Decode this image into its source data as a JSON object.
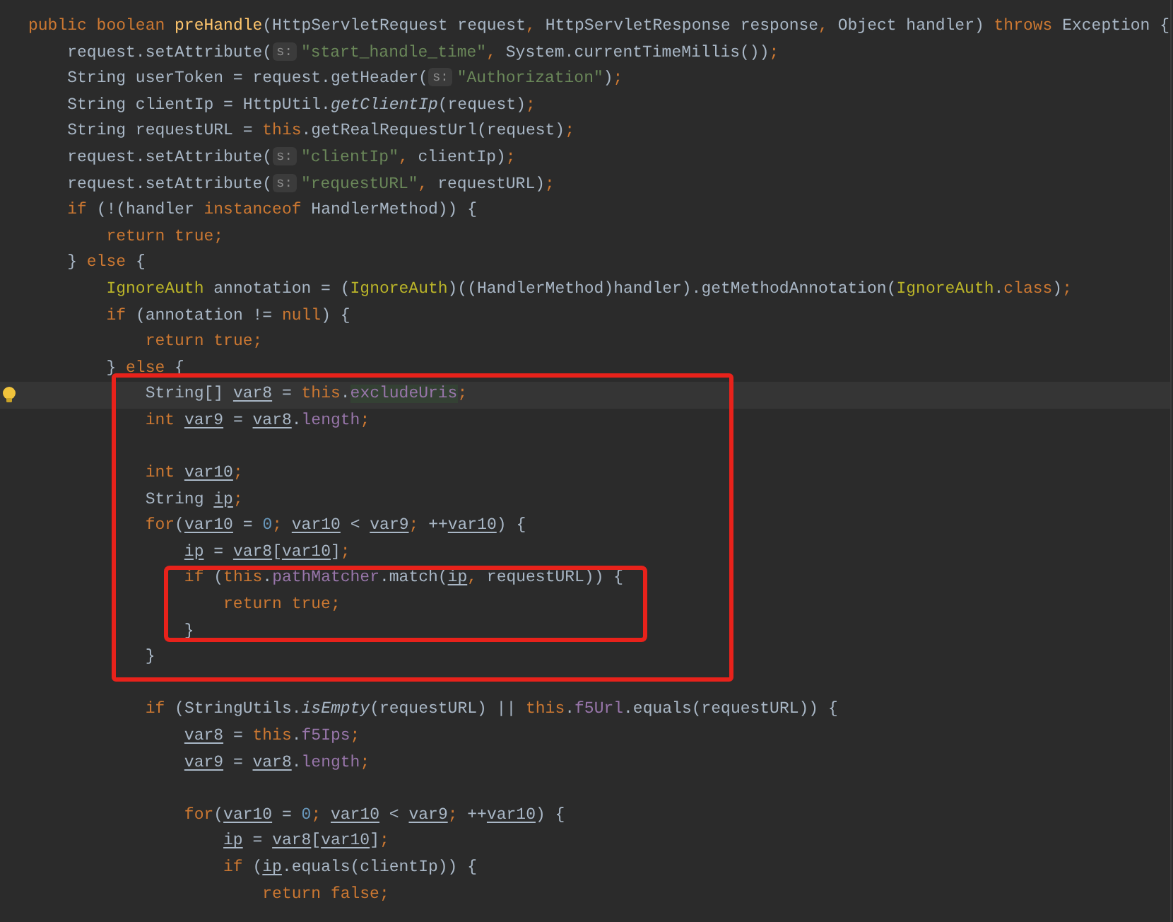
{
  "editor": {
    "lines": [
      {
        "current": false,
        "tokens": [
          {
            "kind": "kw",
            "text": "public boolean "
          },
          {
            "kind": "fn",
            "text": "preHandle"
          },
          {
            "kind": "plain",
            "text": "(HttpServletRequest request"
          },
          {
            "kind": "kw",
            "text": ", "
          },
          {
            "kind": "plain",
            "text": "HttpServletResponse response"
          },
          {
            "kind": "kw",
            "text": ", "
          },
          {
            "kind": "plain",
            "text": "Object handler) "
          },
          {
            "kind": "kw",
            "text": "throws "
          },
          {
            "kind": "plain",
            "text": "Exception {"
          }
        ]
      },
      {
        "current": false,
        "tokens": [
          {
            "kind": "plain",
            "text": "    request.setAttribute("
          },
          {
            "kind": "hint",
            "text": "s:"
          },
          {
            "kind": "str",
            "text": "\"start_handle_time\""
          },
          {
            "kind": "kw",
            "text": ", "
          },
          {
            "kind": "plain",
            "text": "System.currentTimeMillis())"
          },
          {
            "kind": "kw",
            "text": ";"
          }
        ]
      },
      {
        "current": false,
        "tokens": [
          {
            "kind": "plain",
            "text": "    String userToken = request.getHeader("
          },
          {
            "kind": "hint",
            "text": "s:"
          },
          {
            "kind": "str",
            "text": "\"Authorization\""
          },
          {
            "kind": "plain",
            "text": ")"
          },
          {
            "kind": "kw",
            "text": ";"
          }
        ]
      },
      {
        "current": false,
        "tokens": [
          {
            "kind": "plain",
            "text": "    String clientIp = HttpUtil."
          },
          {
            "kind": "static",
            "text": "getClientIp"
          },
          {
            "kind": "plain",
            "text": "(request)"
          },
          {
            "kind": "kw",
            "text": ";"
          }
        ]
      },
      {
        "current": false,
        "tokens": [
          {
            "kind": "plain",
            "text": "    String requestURL = "
          },
          {
            "kind": "kw",
            "text": "this"
          },
          {
            "kind": "plain",
            "text": ".getRealRequestUrl(request)"
          },
          {
            "kind": "kw",
            "text": ";"
          }
        ]
      },
      {
        "current": false,
        "tokens": [
          {
            "kind": "plain",
            "text": "    request.setAttribute("
          },
          {
            "kind": "hint",
            "text": "s:"
          },
          {
            "kind": "str",
            "text": "\"clientIp\""
          },
          {
            "kind": "kw",
            "text": ", "
          },
          {
            "kind": "plain",
            "text": "clientIp)"
          },
          {
            "kind": "kw",
            "text": ";"
          }
        ]
      },
      {
        "current": false,
        "tokens": [
          {
            "kind": "plain",
            "text": "    request.setAttribute("
          },
          {
            "kind": "hint",
            "text": "s:"
          },
          {
            "kind": "str",
            "text": "\"requestURL\""
          },
          {
            "kind": "kw",
            "text": ", "
          },
          {
            "kind": "plain",
            "text": "requestURL)"
          },
          {
            "kind": "kw",
            "text": ";"
          }
        ]
      },
      {
        "current": false,
        "tokens": [
          {
            "kind": "kw",
            "text": "    if "
          },
          {
            "kind": "plain",
            "text": "(!(handler "
          },
          {
            "kind": "kw",
            "text": "instanceof "
          },
          {
            "kind": "plain",
            "text": "HandlerMethod)) {"
          }
        ]
      },
      {
        "current": false,
        "tokens": [
          {
            "kind": "kw",
            "text": "        return true;"
          }
        ]
      },
      {
        "current": false,
        "tokens": [
          {
            "kind": "plain",
            "text": "    } "
          },
          {
            "kind": "kw",
            "text": "else "
          },
          {
            "kind": "plain",
            "text": "{"
          }
        ]
      },
      {
        "current": false,
        "tokens": [
          {
            "kind": "type",
            "text": "        IgnoreAuth "
          },
          {
            "kind": "plain",
            "text": "annotation = ("
          },
          {
            "kind": "type",
            "text": "IgnoreAuth"
          },
          {
            "kind": "plain",
            "text": ")((HandlerMethod)handler).getMethodAnnotation("
          },
          {
            "kind": "type",
            "text": "IgnoreAuth"
          },
          {
            "kind": "plain",
            "text": "."
          },
          {
            "kind": "kw",
            "text": "class"
          },
          {
            "kind": "plain",
            "text": ")"
          },
          {
            "kind": "kw",
            "text": ";"
          }
        ]
      },
      {
        "current": false,
        "tokens": [
          {
            "kind": "kw",
            "text": "        if "
          },
          {
            "kind": "plain",
            "text": "(annotation != "
          },
          {
            "kind": "kw",
            "text": "null"
          },
          {
            "kind": "plain",
            "text": ") {"
          }
        ]
      },
      {
        "current": false,
        "tokens": [
          {
            "kind": "kw",
            "text": "            return true;"
          }
        ]
      },
      {
        "current": false,
        "tokens": [
          {
            "kind": "plain",
            "text": "        } "
          },
          {
            "kind": "kw",
            "text": "else "
          },
          {
            "kind": "plain",
            "text": "{"
          }
        ]
      },
      {
        "current": true,
        "tokens": [
          {
            "kind": "plain",
            "text": "            String[] "
          },
          {
            "kind": "local",
            "text": "var8"
          },
          {
            "kind": "plain",
            "text": " = "
          },
          {
            "kind": "kw",
            "text": "this"
          },
          {
            "kind": "plain",
            "text": "."
          },
          {
            "kind": "usage",
            "text": "excludeUris"
          },
          {
            "kind": "kw",
            "text": ";"
          }
        ]
      },
      {
        "current": false,
        "tokens": [
          {
            "kind": "kw",
            "text": "            int "
          },
          {
            "kind": "local",
            "text": "var9"
          },
          {
            "kind": "plain",
            "text": " = "
          },
          {
            "kind": "local",
            "text": "var8"
          },
          {
            "kind": "plain",
            "text": "."
          },
          {
            "kind": "field",
            "text": "length"
          },
          {
            "kind": "kw",
            "text": ";"
          }
        ]
      },
      {
        "current": false
      },
      {
        "current": false,
        "tokens": [
          {
            "kind": "kw",
            "text": "            int "
          },
          {
            "kind": "local",
            "text": "var10"
          },
          {
            "kind": "kw",
            "text": ";"
          }
        ]
      },
      {
        "current": false,
        "tokens": [
          {
            "kind": "plain",
            "text": "            String "
          },
          {
            "kind": "local",
            "text": "ip"
          },
          {
            "kind": "kw",
            "text": ";"
          }
        ]
      },
      {
        "current": false,
        "tokens": [
          {
            "kind": "kw",
            "text": "            for"
          },
          {
            "kind": "plain",
            "text": "("
          },
          {
            "kind": "local",
            "text": "var10"
          },
          {
            "kind": "plain",
            "text": " = "
          },
          {
            "kind": "num",
            "text": "0"
          },
          {
            "kind": "kw",
            "text": "; "
          },
          {
            "kind": "local",
            "text": "var10"
          },
          {
            "kind": "plain",
            "text": " < "
          },
          {
            "kind": "local",
            "text": "var9"
          },
          {
            "kind": "kw",
            "text": "; "
          },
          {
            "kind": "plain",
            "text": "++"
          },
          {
            "kind": "local",
            "text": "var10"
          },
          {
            "kind": "plain",
            "text": ") {"
          }
        ]
      },
      {
        "current": false,
        "tokens": [
          {
            "kind": "local",
            "text": "                ip"
          },
          {
            "kind": "plain",
            "text": " = "
          },
          {
            "kind": "local",
            "text": "var8"
          },
          {
            "kind": "plain",
            "text": "["
          },
          {
            "kind": "local",
            "text": "var10"
          },
          {
            "kind": "plain",
            "text": "]"
          },
          {
            "kind": "kw",
            "text": ";"
          }
        ]
      },
      {
        "current": false,
        "tokens": [
          {
            "kind": "kw",
            "text": "                if "
          },
          {
            "kind": "plain",
            "text": "("
          },
          {
            "kind": "kw",
            "text": "this"
          },
          {
            "kind": "plain",
            "text": "."
          },
          {
            "kind": "field",
            "text": "pathMatcher"
          },
          {
            "kind": "plain",
            "text": ".match("
          },
          {
            "kind": "local",
            "text": "ip"
          },
          {
            "kind": "kw",
            "text": ", "
          },
          {
            "kind": "plain",
            "text": "requestURL)) {"
          }
        ]
      },
      {
        "current": false,
        "tokens": [
          {
            "kind": "kw",
            "text": "                    return true;"
          }
        ]
      },
      {
        "current": false,
        "tokens": [
          {
            "kind": "plain",
            "text": "                }"
          }
        ]
      },
      {
        "current": false,
        "tokens": [
          {
            "kind": "plain",
            "text": "            }"
          }
        ]
      },
      {
        "current": false
      },
      {
        "current": false,
        "tokens": [
          {
            "kind": "kw",
            "text": "            if "
          },
          {
            "kind": "plain",
            "text": "(StringUtils."
          },
          {
            "kind": "static",
            "text": "isEmpty"
          },
          {
            "kind": "plain",
            "text": "(requestURL) || "
          },
          {
            "kind": "kw",
            "text": "this"
          },
          {
            "kind": "plain",
            "text": "."
          },
          {
            "kind": "field",
            "text": "f5Url"
          },
          {
            "kind": "plain",
            "text": ".equals(requestURL)) {"
          }
        ]
      },
      {
        "current": false,
        "tokens": [
          {
            "kind": "local",
            "text": "                var8"
          },
          {
            "kind": "plain",
            "text": " = "
          },
          {
            "kind": "kw",
            "text": "this"
          },
          {
            "kind": "plain",
            "text": "."
          },
          {
            "kind": "field",
            "text": "f5Ips"
          },
          {
            "kind": "kw",
            "text": ";"
          }
        ]
      },
      {
        "current": false,
        "tokens": [
          {
            "kind": "local",
            "text": "                var9"
          },
          {
            "kind": "plain",
            "text": " = "
          },
          {
            "kind": "local",
            "text": "var8"
          },
          {
            "kind": "plain",
            "text": "."
          },
          {
            "kind": "field",
            "text": "length"
          },
          {
            "kind": "kw",
            "text": ";"
          }
        ]
      },
      {
        "current": false
      },
      {
        "current": false,
        "tokens": [
          {
            "kind": "kw",
            "text": "                for"
          },
          {
            "kind": "plain",
            "text": "("
          },
          {
            "kind": "local",
            "text": "var10"
          },
          {
            "kind": "plain",
            "text": " = "
          },
          {
            "kind": "num",
            "text": "0"
          },
          {
            "kind": "kw",
            "text": "; "
          },
          {
            "kind": "local",
            "text": "var10"
          },
          {
            "kind": "plain",
            "text": " < "
          },
          {
            "kind": "local",
            "text": "var9"
          },
          {
            "kind": "kw",
            "text": "; "
          },
          {
            "kind": "plain",
            "text": "++"
          },
          {
            "kind": "local",
            "text": "var10"
          },
          {
            "kind": "plain",
            "text": ") {"
          }
        ]
      },
      {
        "current": false,
        "tokens": [
          {
            "kind": "local",
            "text": "                    ip"
          },
          {
            "kind": "plain",
            "text": " = "
          },
          {
            "kind": "local",
            "text": "var8"
          },
          {
            "kind": "plain",
            "text": "["
          },
          {
            "kind": "local",
            "text": "var10"
          },
          {
            "kind": "plain",
            "text": "]"
          },
          {
            "kind": "kw",
            "text": ";"
          }
        ]
      },
      {
        "current": false,
        "tokens": [
          {
            "kind": "kw",
            "text": "                    if "
          },
          {
            "kind": "plain",
            "text": "("
          },
          {
            "kind": "local",
            "text": "ip"
          },
          {
            "kind": "plain",
            "text": ".equals(clientIp)) {"
          }
        ]
      },
      {
        "current": false,
        "tokens": [
          {
            "kind": "kw",
            "text": "                        return false;"
          }
        ]
      }
    ]
  }
}
